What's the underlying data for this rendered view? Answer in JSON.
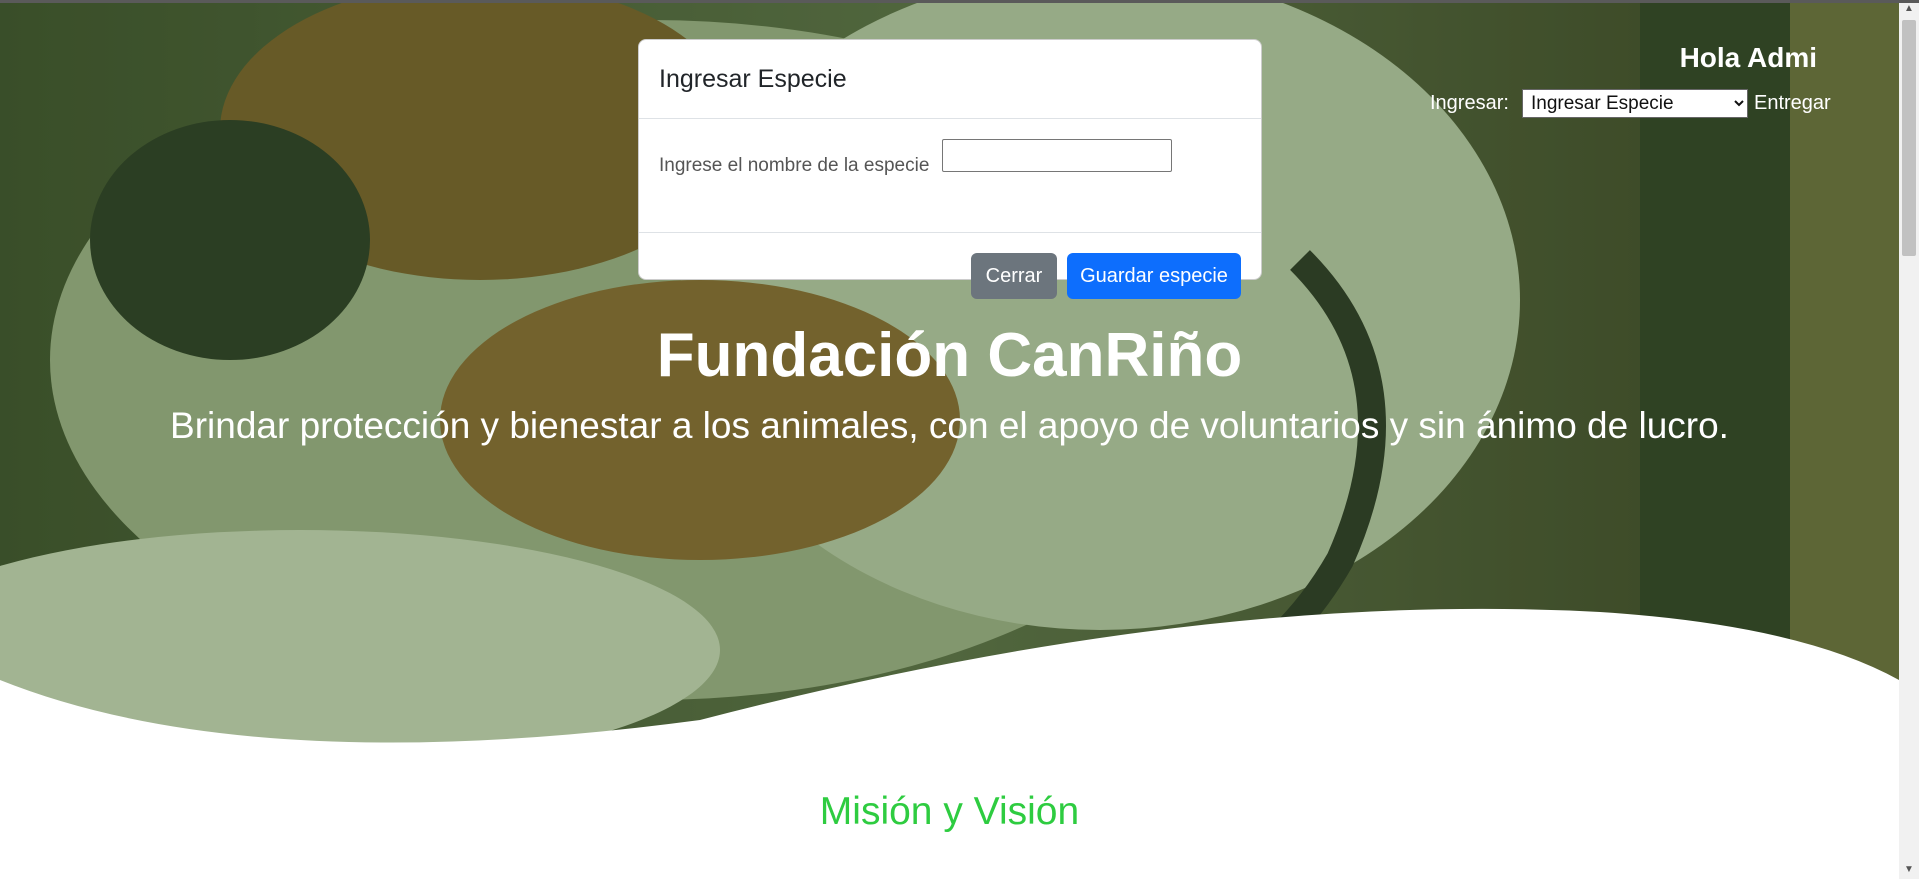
{
  "header": {
    "greeting": "Hola Admi",
    "ingresar_label": "Ingresar:",
    "select_value": "Ingresar Especie",
    "select_options": [
      "Ingresar Especie"
    ],
    "entregar_label": "Entregar"
  },
  "hero": {
    "title": "Fundación CanRiño",
    "subtitle": "Brindar protección y bienestar a los animales, con el apoyo de voluntarios y sin ánimo de lucro."
  },
  "modal": {
    "title": "Ingresar Especie",
    "field_label": "Ingrese el nombre de la especie",
    "field_value": "",
    "close_label": "Cerrar",
    "save_label": "Guardar especie"
  },
  "section": {
    "heading": "Misión y Visión"
  },
  "colors": {
    "hero_overlay": "#3c5a2a",
    "accent_green": "#2ecc40",
    "primary_blue": "#0d6efd",
    "secondary_gray": "#6c757d"
  },
  "icons": {
    "scroll_up": "triangle-up-icon",
    "scroll_down": "triangle-down-icon"
  }
}
